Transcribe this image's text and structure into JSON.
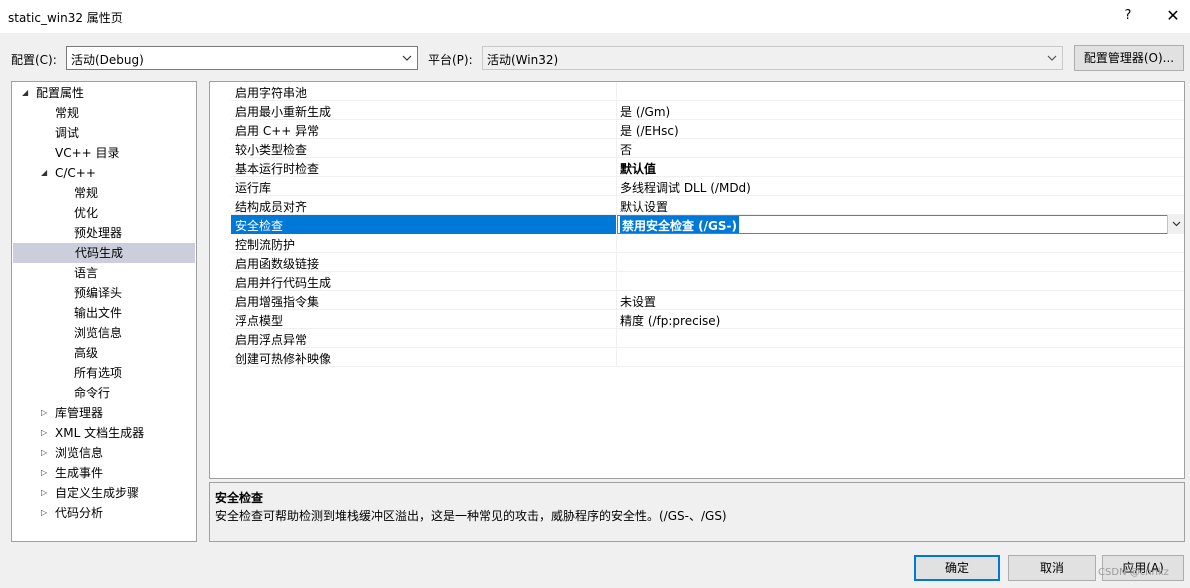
{
  "window": {
    "title": "static_win32 属性页",
    "help_label": "?",
    "close_label": "✕"
  },
  "config": {
    "label": "配置(C):",
    "value": "活动(Debug)",
    "platform_label": "平台(P):",
    "platform_value": "活动(Win32)",
    "manager_button": "配置管理器(O)..."
  },
  "tree": {
    "items": [
      {
        "label": "配置属性",
        "expander": "◢"
      },
      {
        "label": "常规"
      },
      {
        "label": "调试"
      },
      {
        "label": "VC++ 目录"
      },
      {
        "label": "C/C++",
        "expander": "◢"
      },
      {
        "label": "常规"
      },
      {
        "label": "优化"
      },
      {
        "label": "预处理器"
      },
      {
        "label": "代码生成",
        "selected": true
      },
      {
        "label": "语言"
      },
      {
        "label": "预编译头"
      },
      {
        "label": "输出文件"
      },
      {
        "label": "浏览信息"
      },
      {
        "label": "高级"
      },
      {
        "label": "所有选项"
      },
      {
        "label": "命令行"
      },
      {
        "label": "库管理器",
        "expander": "▷"
      },
      {
        "label": "XML 文档生成器",
        "expander": "▷"
      },
      {
        "label": "浏览信息",
        "expander": "▷"
      },
      {
        "label": "生成事件",
        "expander": "▷"
      },
      {
        "label": "自定义生成步骤",
        "expander": "▷"
      },
      {
        "label": "代码分析",
        "expander": "▷"
      }
    ]
  },
  "properties": {
    "rows": [
      {
        "name": "启用字符串池",
        "value": ""
      },
      {
        "name": "启用最小重新生成",
        "value": "是 (/Gm)"
      },
      {
        "name": "启用 C++ 异常",
        "value": "是 (/EHsc)"
      },
      {
        "name": "较小类型检查",
        "value": "否"
      },
      {
        "name": "基本运行时检查",
        "value": "默认值",
        "bold": true
      },
      {
        "name": "运行库",
        "value": "多线程调试 DLL (/MDd)"
      },
      {
        "name": "结构成员对齐",
        "value": "默认设置"
      },
      {
        "name": "安全检查",
        "value": "禁用安全检查 (/GS-)",
        "selected": true
      },
      {
        "name": "控制流防护",
        "value": ""
      },
      {
        "name": "启用函数级链接",
        "value": ""
      },
      {
        "name": "启用并行代码生成",
        "value": ""
      },
      {
        "name": "启用增强指令集",
        "value": "未设置"
      },
      {
        "name": "浮点模型",
        "value": "精度 (/fp:precise)"
      },
      {
        "name": "启用浮点异常",
        "value": ""
      },
      {
        "name": "创建可热修补映像",
        "value": ""
      }
    ]
  },
  "description": {
    "title": "安全检查",
    "text": "安全检查可帮助检测到堆栈缓冲区溢出，这是一种常见的攻击，威胁程序的安全性。(/GS-、/GS)"
  },
  "buttons": {
    "ok": "确定",
    "cancel": "取消",
    "apply": "应用(A)"
  },
  "watermark": "CSDN @cnnkz"
}
